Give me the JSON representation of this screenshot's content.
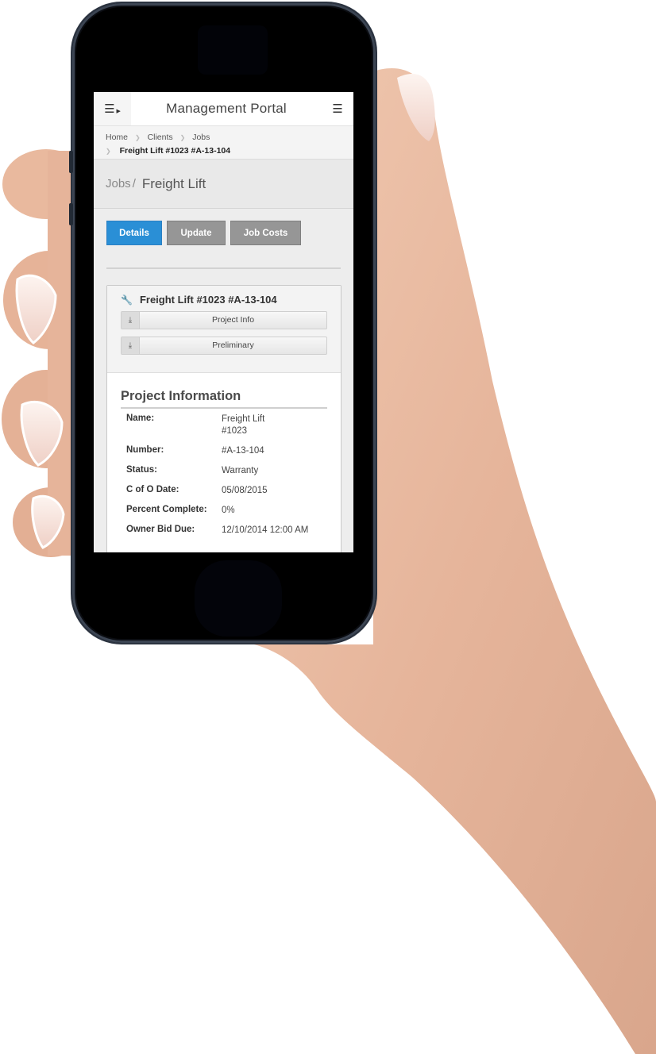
{
  "header": {
    "app_title": "Management Portal",
    "sidebar_toggle_icon": "hamburger-arrow-icon",
    "menu_icon": "hamburger-icon"
  },
  "breadcrumbs": {
    "items": [
      "Home",
      "Clients",
      "Jobs"
    ],
    "current": "Freight Lift #1023 #A-13-104"
  },
  "page_header": {
    "parent": "Jobs",
    "separator": "/",
    "title": "Freight Lift"
  },
  "tabs": [
    {
      "label": "Details",
      "active": true
    },
    {
      "label": "Update",
      "active": false
    },
    {
      "label": "Job Costs",
      "active": false
    }
  ],
  "card": {
    "title": "Freight Lift #1023 #A-13-104",
    "title_icon": "wrench-icon",
    "downloads": [
      {
        "label": "Project Info",
        "icon": "download-icon"
      },
      {
        "label": "Preliminary",
        "icon": "download-icon"
      }
    ]
  },
  "project_info": {
    "section_title": "Project Information",
    "fields": [
      {
        "label": "Name:",
        "value": "Freight Lift #1023"
      },
      {
        "label": "Number:",
        "value": "#A-13-104"
      },
      {
        "label": "Status:",
        "value": "Warranty"
      },
      {
        "label": "C of O Date:",
        "value": "05/08/2015"
      },
      {
        "label": "Percent Complete:",
        "value": "0%"
      },
      {
        "label": "Owner Bid Due:",
        "value": "12/10/2014 12:00 AM"
      }
    ]
  },
  "colors": {
    "accent": "#2a8fd6",
    "tab_inactive": "#969696",
    "phone_body": "#000000",
    "skin": "#e8b9a0"
  }
}
